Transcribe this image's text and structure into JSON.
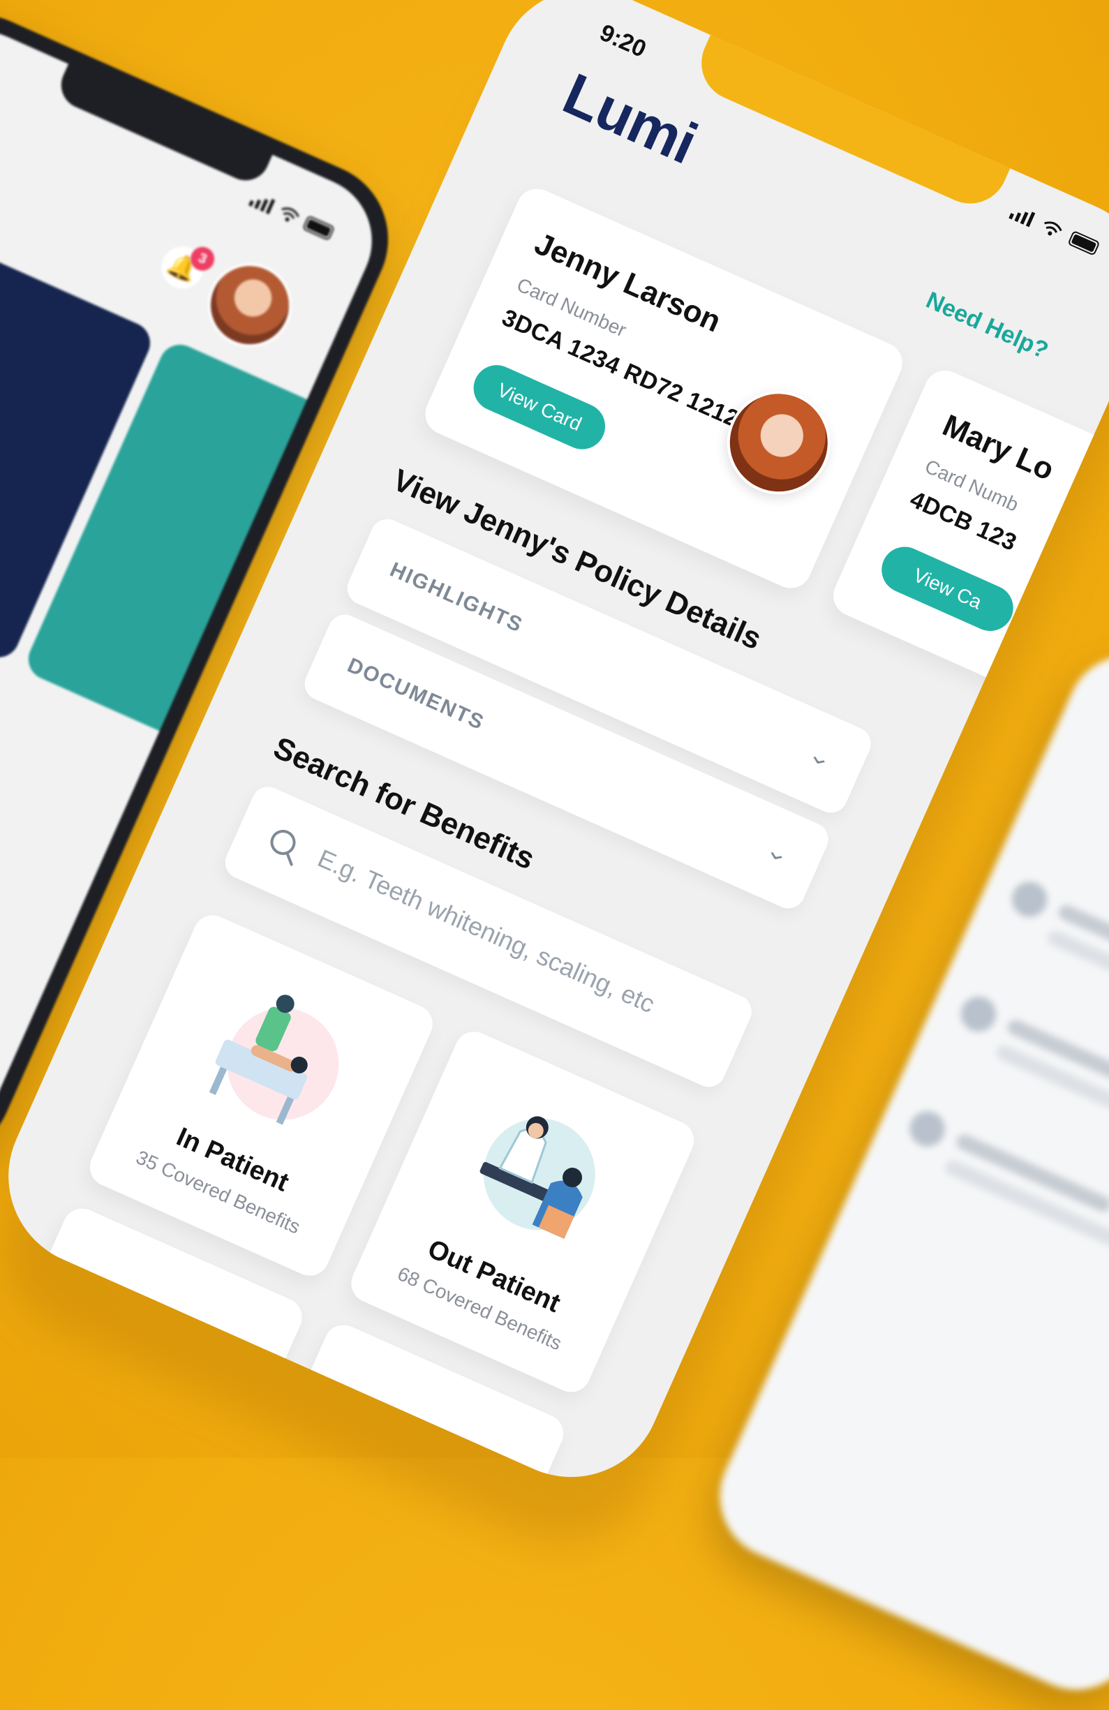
{
  "left_phone": {
    "notification_count": "3",
    "icons": [
      "signal-icon",
      "wifi-icon",
      "battery-icon",
      "bell-icon"
    ]
  },
  "status_bar": {
    "time": "9:20",
    "icons": [
      "signal-icon",
      "wifi-icon",
      "battery-icon"
    ]
  },
  "header": {
    "app_title": "Lumi",
    "help_link": "Need Help?"
  },
  "cards": [
    {
      "name": "Jenny Larson",
      "card_number_label": "Card Number",
      "card_number": "3DCA 1234 RD72 1212",
      "button": "View Card"
    },
    {
      "name": "Mary Lo",
      "card_number_label": "Card Numb",
      "card_number": "4DCB 123",
      "button": "View Ca"
    }
  ],
  "policy": {
    "title": "View Jenny's Policy Details",
    "sections": [
      {
        "label": "HIGHLIGHTS"
      },
      {
        "label": "DOCUMENTS"
      }
    ]
  },
  "search": {
    "title": "Search for Benefits",
    "placeholder": "E.g. Teeth whitening, scaling, etc"
  },
  "benefits": [
    {
      "title": "In Patient",
      "subtitle": "35 Covered Benefits"
    },
    {
      "title": "Out Patient",
      "subtitle": "68 Covered Benefits"
    }
  ],
  "colors": {
    "background": "#f2ad0f",
    "brand_navy": "#15275e",
    "accent_teal": "#22b3a7",
    "badge_red": "#ee3e63"
  }
}
